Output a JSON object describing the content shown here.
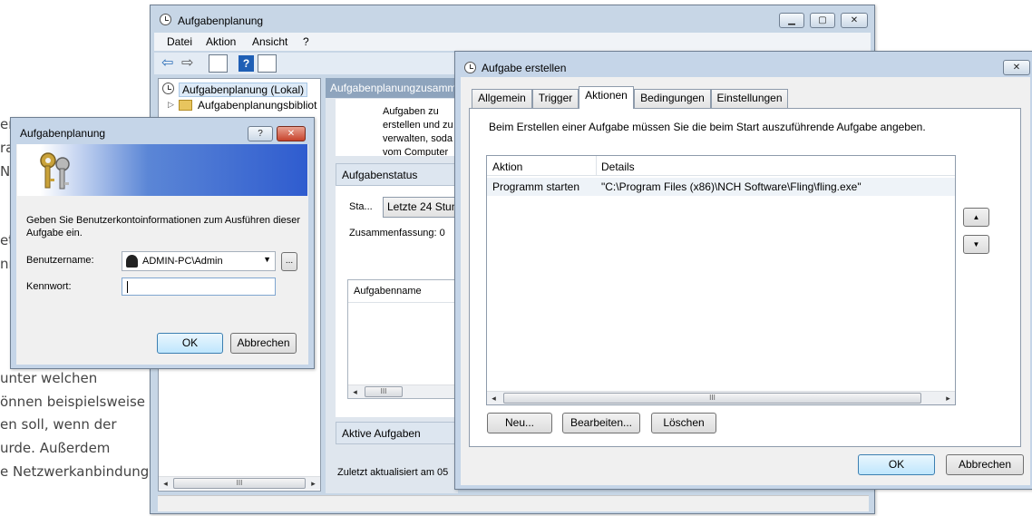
{
  "background_text": {
    "lines": [
      "er",
      "ra",
      "N",
      "et",
      "nr",
      "unter welchen",
      "önnen beispielsweise",
      "en soll, wenn der",
      "urde. Außerdem",
      "e Netzwerkanbindung"
    ]
  },
  "main_window": {
    "title": "Aufgabenplanung",
    "menu": [
      "Datei",
      "Aktion",
      "Ansicht",
      "?"
    ],
    "tree": {
      "root": "Aufgabenplanung (Lokal)",
      "child": "Aufgabenplanungsbibliot"
    },
    "summary_header": "Aufgabenplanungzusamm",
    "summary_text": [
      "Aufgaben zu",
      "erstellen und zu",
      "verwalten, soda",
      "vom Computer"
    ],
    "status_section": "Aufgabenstatus",
    "status_label": "Sta...",
    "status_select": "Letzte 24 Stun",
    "summary_count": "Zusammenfassung: 0",
    "table_header": "Aufgabenname",
    "active_section": "Aktive Aufgaben",
    "last_updated": "Zuletzt aktualisiert am 05",
    "scroll_thumb": "III"
  },
  "credential_dialog": {
    "title": "Aufgabenplanung",
    "help_btn": "?",
    "close_btn": "✕",
    "instruction": "Geben Sie Benutzerkontoinformationen zum Ausführen dieser Aufgabe ein.",
    "username_label": "Benutzername:",
    "username_value": "ADMIN-PC\\Admin",
    "browse_btn": "...",
    "password_label": "Kennwort:",
    "password_value": "",
    "ok": "OK",
    "cancel": "Abbrechen"
  },
  "create_task_dialog": {
    "title": "Aufgabe erstellen",
    "close_btn": "✕",
    "tabs": [
      "Allgemein",
      "Trigger",
      "Aktionen",
      "Bedingungen",
      "Einstellungen"
    ],
    "active_tab": "Aktionen",
    "description": "Beim Erstellen einer Aufgabe müssen Sie die beim Start auszuführende Aufgabe angeben.",
    "columns": [
      "Aktion",
      "Details"
    ],
    "rows": [
      {
        "aktion": "Programm starten",
        "details": "\"C:\\Program Files (x86)\\NCH Software\\Fling\\fling.exe\""
      }
    ],
    "scroll_thumb": "III",
    "buttons": {
      "new": "Neu...",
      "edit": "Bearbeiten...",
      "delete": "Löschen"
    },
    "move_up": "▲",
    "move_down": "▼",
    "ok": "OK",
    "cancel": "Abbrechen"
  }
}
